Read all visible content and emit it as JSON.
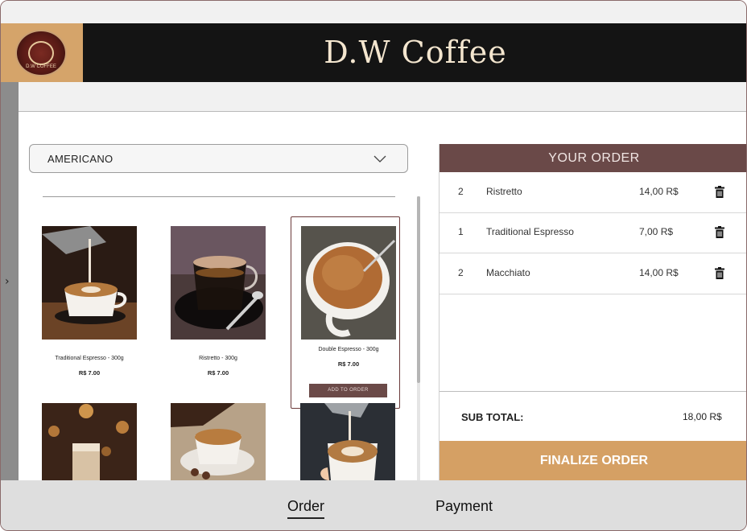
{
  "header": {
    "brand": "D.W Coffee",
    "logo_text": "D.W COFFEE"
  },
  "filter": {
    "selected": "AMERICANO"
  },
  "products": [
    {
      "name": "Traditional Espresso - 300g",
      "price": "R$ 7.00"
    },
    {
      "name": "Ristretto - 300g",
      "price": "R$ 7.00"
    },
    {
      "name": "Double Espresso - 300g",
      "price": "R$ 7.00",
      "action": "ADD TO ORDER"
    }
  ],
  "order": {
    "title": "YOUR ORDER",
    "items": [
      {
        "qty": "2",
        "name": "Ristretto",
        "amount": "14,00 R$"
      },
      {
        "qty": "1",
        "name": "Traditional Espresso",
        "amount": "7,00 R$"
      },
      {
        "qty": "2",
        "name": "Macchiato",
        "amount": "14,00 R$"
      }
    ],
    "subtotal_label": "SUB TOTAL:",
    "subtotal_value": "18,00 R$",
    "finalize_label": "FINALIZE ORDER"
  },
  "tabs": [
    {
      "label": "Order",
      "active": true
    },
    {
      "label": "Payment",
      "active": false
    }
  ],
  "icons": {
    "side_toggle": "chevron-right-icon",
    "select": "chevron-down-icon",
    "remove": "trash-icon"
  },
  "colors": {
    "header_bg": "#141414",
    "brand_text": "#f4e6cf",
    "logo_bg": "#d5a46a",
    "order_head": "#6a4948",
    "finalize": "#d5a064",
    "add_button": "#6b4a48"
  }
}
